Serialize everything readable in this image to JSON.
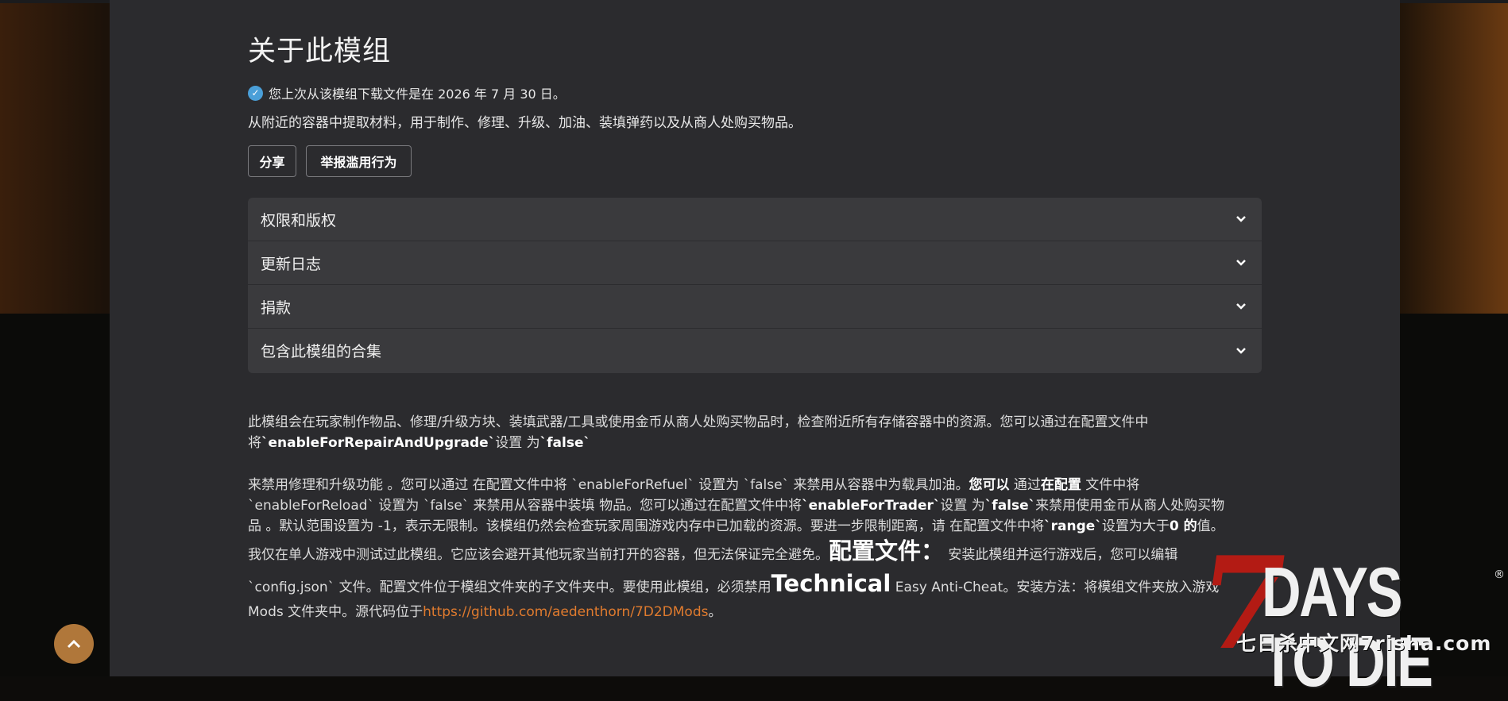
{
  "about": {
    "title": "关于此模组",
    "download_notice": "您上次从该模组下载文件是在 2026 年 7 月 30 日。",
    "summary": "从附近的容器中提取材料，用于制作、修理、升级、加油、装填弹药以及从商人处购买物品。"
  },
  "buttons": {
    "share": "分享",
    "report": "举报滥用行为"
  },
  "accordion": [
    {
      "label": "权限和版权"
    },
    {
      "label": "更新日志"
    },
    {
      "label": "捐款"
    },
    {
      "label": "包含此模组的合集"
    }
  ],
  "description": {
    "p1": {
      "a": "此模组会在玩家制作物品、修理/升级方块、装填武器/工具或使用金币从商人处购买物品时，检查附近所有存储容器中的资源。您可以通过在配置文件中",
      "b": "将",
      "c": "`enableForRepairAndUpgrade`",
      "d": "设置 为",
      "e": "`false`"
    },
    "p2": {
      "l1a": "来禁用修理和升级功能 。您可以通过 在配置文件中将 `enableForRefuel` 设置为 `false` 来禁用从容器中为载具加油。",
      "l1b": "您可以",
      "l1c": " 通过",
      "l1d": "在配置",
      "l1e": " 文件中将",
      "l2a": "`enableForReload` 设置为 `false` 来禁用从容器中装填 物品。您可以通过在配置文件中将",
      "l2b": "`enableForTrader`",
      "l2c": "设置 为",
      "l2d": "`false`",
      "l2e": "来禁用使用金币从商人处购买物",
      "l3a": "品 。默认范围设置为 -1，表示无限制。该模组仍然会检查玩家周围游戏内存中已加载的资源。要进一步限制距离，请 在配置文件中将",
      "l3b": "`range`",
      "l3c": "设置为大于",
      "l3d": "0 的",
      "l3e": "值。",
      "l4a": "我仅在单人游戏中测试过此模组。它应该会避开其他玩家当前打开的容器，但无法保证完全避免。",
      "l4b": "配置文件：",
      "l4c": " 安装此模组并运行游戏后，您可以编辑",
      "l5a": "`config.json` 文件。配置文件位于模组文件夹的子文件夹中。要使用此模组，必须禁用",
      "l5b": "Technical",
      "l5c": " Easy Anti-Cheat。安装方法：将模组文件夹放入游戏",
      "l6a": "Mods 文件夹中。源代码位于",
      "l6b": "https://github.com/aedenthorn/7D2DMods",
      "l6c": "。"
    }
  },
  "watermark": {
    "seven": "7",
    "days": "DAYS TO DIE",
    "tm": "®",
    "sub": "七日杀中文网7risha.com"
  },
  "colors": {
    "accent": "#e07b2e",
    "scroll_button": "#b0773a",
    "check": "#4a9fd8"
  }
}
